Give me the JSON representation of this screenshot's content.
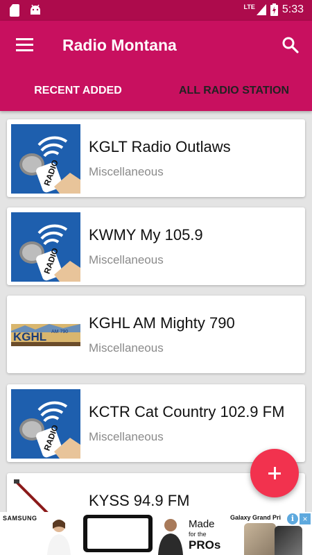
{
  "status_bar": {
    "time": "5:33",
    "network": "LTE"
  },
  "app_bar": {
    "title": "Radio Montana",
    "menu_icon": "hamburger-menu-icon",
    "search_icon": "search-icon"
  },
  "tabs": [
    {
      "label": "RECENT ADDED",
      "active": true
    },
    {
      "label": "ALL RADIO STATION",
      "active": false
    }
  ],
  "stations": [
    {
      "name": "KGLT Radio Outlaws",
      "category": "Miscellaneous",
      "logo": "radio-microphone-logo"
    },
    {
      "name": "KWMY My 105.9",
      "category": "Miscellaneous",
      "logo": "radio-microphone-logo"
    },
    {
      "name": "KGHL AM Mighty 790",
      "category": "Miscellaneous",
      "logo": "kghl-logo"
    },
    {
      "name": "KCTR Cat Country 102.9 FM",
      "category": "Miscellaneous",
      "logo": "radio-microphone-logo"
    },
    {
      "name": "KYSS 94.9 FM",
      "category": "",
      "logo": "guitar-logo"
    }
  ],
  "fab": {
    "icon": "plus-icon"
  },
  "ad": {
    "brand": "SAMSUNG",
    "tagline_1": "Made",
    "tagline_2": "for the",
    "tagline_3": "PROs",
    "product": "Galaxy Grand Pri",
    "info_icon": "i",
    "close_icon": "×"
  },
  "colors": {
    "status_bar": "#ad0b4c",
    "app_bar": "#c8105f",
    "fab": "#f2324e",
    "background": "#e4e4e4"
  }
}
